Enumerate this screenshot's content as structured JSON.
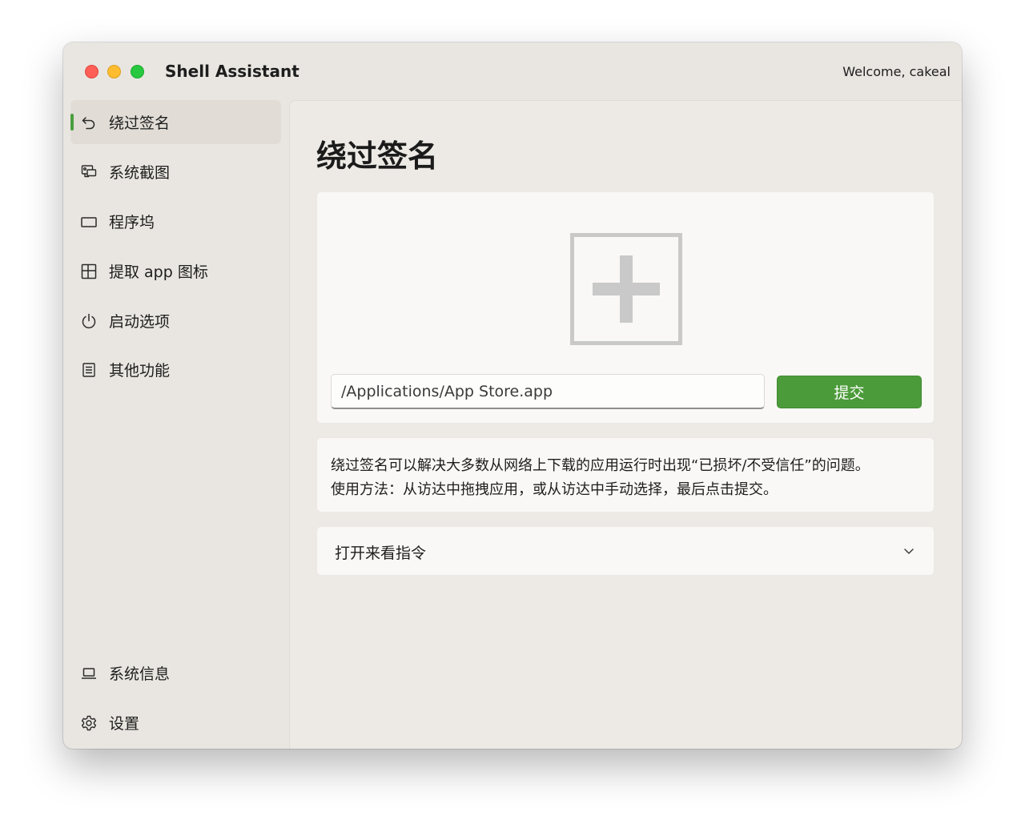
{
  "window": {
    "title": "Shell Assistant",
    "welcome": "Welcome, cakeal"
  },
  "sidebar": {
    "items": [
      {
        "label": "绕过签名",
        "icon": "undo-arrow-icon",
        "active": true
      },
      {
        "label": "系统截图",
        "icon": "screenshot-icon",
        "active": false
      },
      {
        "label": "程序坞",
        "icon": "dock-icon",
        "active": false
      },
      {
        "label": "提取 app 图标",
        "icon": "layout-grid-icon",
        "active": false
      },
      {
        "label": "启动选项",
        "icon": "power-icon",
        "active": false
      },
      {
        "label": "其他功能",
        "icon": "list-icon",
        "active": false
      }
    ],
    "footer_items": [
      {
        "label": "系统信息",
        "icon": "laptop-icon"
      },
      {
        "label": "设置",
        "icon": "gear-icon"
      }
    ],
    "accent_color": "#4a9e3f"
  },
  "main": {
    "title": "绕过签名",
    "drop_zone": {
      "icon": "add-plus-icon"
    },
    "path_input": {
      "value": "/Applications/App Store.app"
    },
    "submit_label": "提交",
    "submit_color": "#4c9b3a",
    "description": {
      "line1": "绕过签名可以解决大多数从网络上下载的应用运行时出现“已损坏/不受信任”的问题。",
      "line2": "使用方法：从访达中拖拽应用，或从访达中手动选择，最后点击提交。"
    },
    "expander": {
      "label": "打开来看指令",
      "icon": "chevron-down-icon",
      "expanded": false
    }
  }
}
